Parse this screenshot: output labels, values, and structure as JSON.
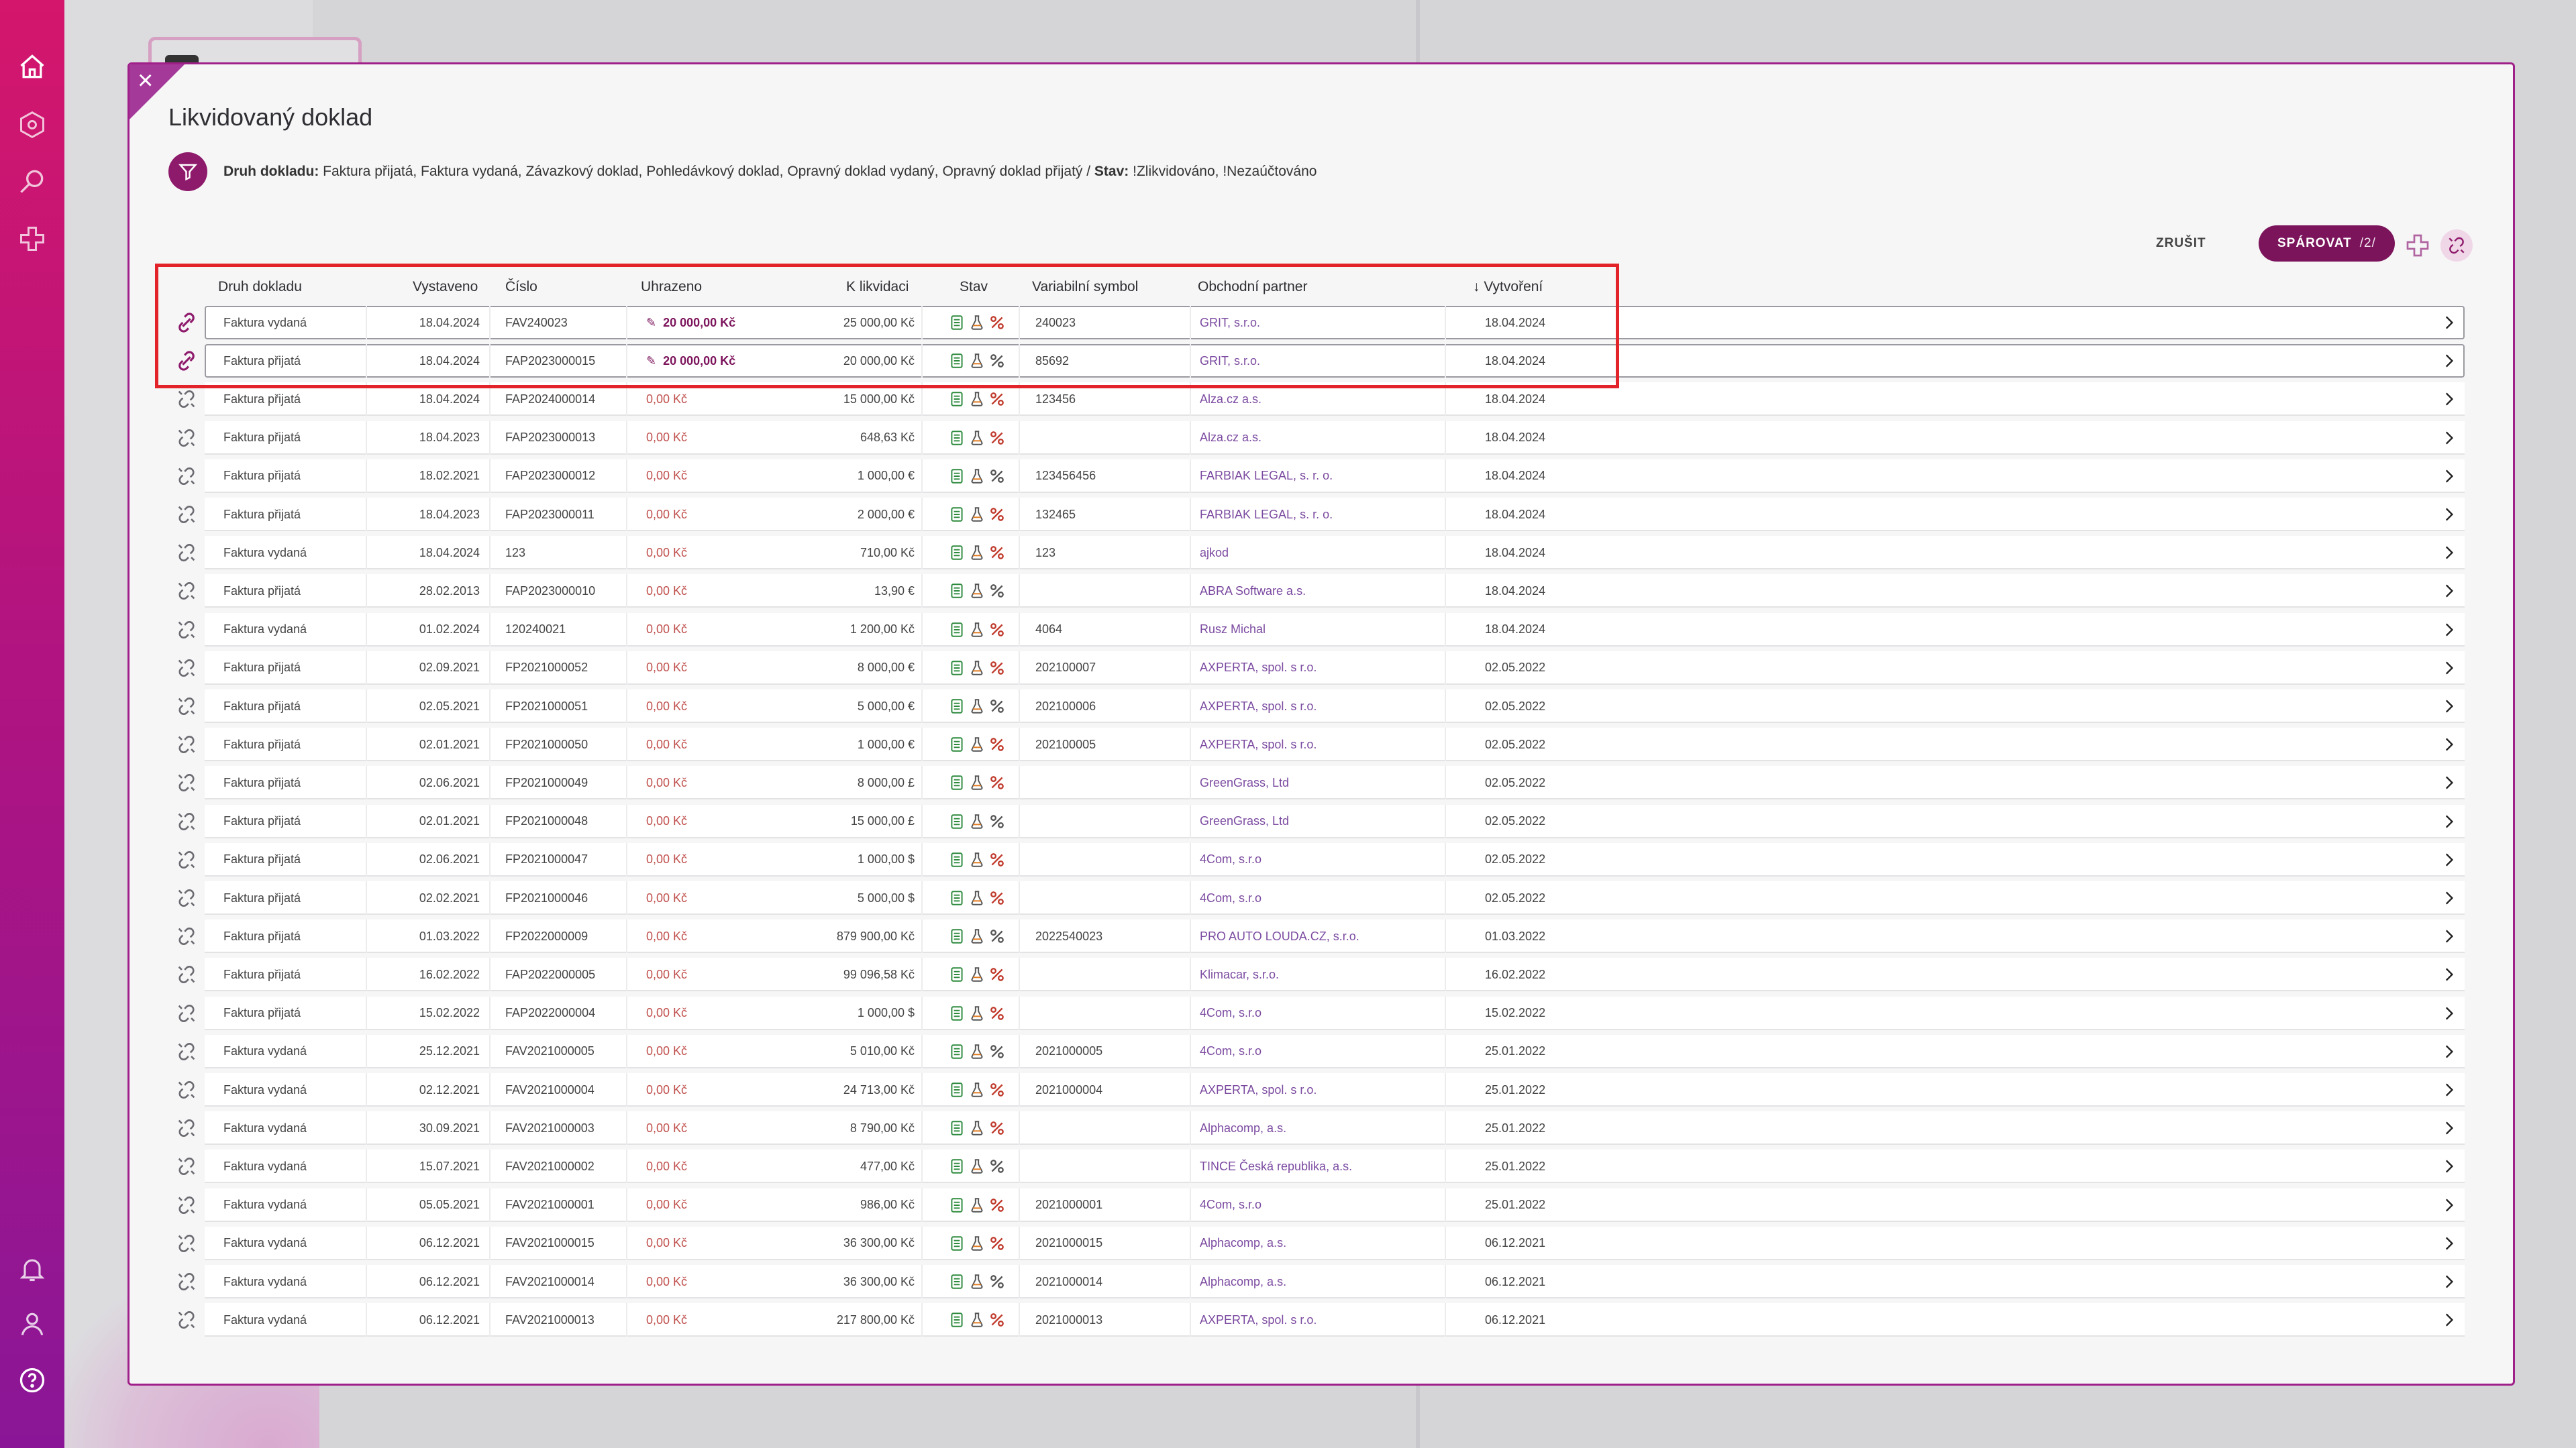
{
  "modal": {
    "title": "Likvidovaný doklad",
    "close_glyph": "×",
    "filter": {
      "label_doc_type": "Druh dokladu:",
      "doc_types": " Faktura přijatá, Faktura vydaná, Závazkový doklad, Pohledávkový doklad, Opravný doklad vydaný, Opravný doklad přijatý / ",
      "label_state": "Stav:",
      "states": " !Zlikvidováno, !Nezaúčtováno"
    },
    "actions": {
      "cancel_label": "ZRUŠIT",
      "pair_label": "SPÁROVAT",
      "pair_count": "/2/"
    }
  },
  "table": {
    "headers": {
      "doc_type": "Druh dokladu",
      "issued": "Vystaveno",
      "number": "Číslo",
      "paid": "Uhrazeno",
      "to_liquidate": "K likvidaci",
      "state": "Stav",
      "var_symbol": "Variabilní symbol",
      "partner": "Obchodní partner",
      "created": "↓ Vytvoření"
    },
    "rows": [
      {
        "doc_type": "Faktura vydaná",
        "issued": "18.04.2024",
        "number": "FAV240023",
        "paid": "20 000,00 Kč",
        "to_liquidate": "25 000,00 Kč",
        "var_symbol": "240023",
        "partner": "GRIT, s.r.o.",
        "created": "18.04.2024"
      },
      {
        "doc_type": "Faktura přijatá",
        "issued": "18.04.2024",
        "number": "FAP2023000015",
        "paid": "20 000,00 Kč",
        "to_liquidate": "20 000,00 Kč",
        "var_symbol": "85692",
        "partner": "GRIT, s.r.o.",
        "created": "18.04.2024"
      },
      {
        "doc_type": "Faktura přijatá",
        "issued": "18.04.2024",
        "number": "FAP2024000014",
        "paid": "0,00 Kč",
        "to_liquidate": "15 000,00 Kč",
        "var_symbol": "123456",
        "partner": "Alza.cz a.s.",
        "created": "18.04.2024"
      },
      {
        "doc_type": "Faktura přijatá",
        "issued": "18.04.2023",
        "number": "FAP2023000013",
        "paid": "0,00 Kč",
        "to_liquidate": "648,63 Kč",
        "var_symbol": "",
        "partner": "Alza.cz a.s.",
        "created": "18.04.2024"
      },
      {
        "doc_type": "Faktura přijatá",
        "issued": "18.02.2021",
        "number": "FAP2023000012",
        "paid": "0,00 Kč",
        "to_liquidate": "1 000,00 €",
        "var_symbol": "123456456",
        "partner": "FARBIAK LEGAL, s. r. o.",
        "created": "18.04.2024"
      },
      {
        "doc_type": "Faktura přijatá",
        "issued": "18.04.2023",
        "number": "FAP2023000011",
        "paid": "0,00 Kč",
        "to_liquidate": "2 000,00 €",
        "var_symbol": "132465",
        "partner": "FARBIAK LEGAL, s. r. o.",
        "created": "18.04.2024"
      },
      {
        "doc_type": "Faktura vydaná",
        "issued": "18.04.2024",
        "number": "123",
        "paid": "0,00 Kč",
        "to_liquidate": "710,00 Kč",
        "var_symbol": "123",
        "partner": "ajkod",
        "created": "18.04.2024"
      },
      {
        "doc_type": "Faktura přijatá",
        "issued": "28.02.2013",
        "number": "FAP2023000010",
        "paid": "0,00 Kč",
        "to_liquidate": "13,90 €",
        "var_symbol": "",
        "partner": "ABRA Software a.s.",
        "created": "18.04.2024"
      },
      {
        "doc_type": "Faktura vydaná",
        "issued": "01.02.2024",
        "number": "120240021",
        "paid": "0,00 Kč",
        "to_liquidate": "1 200,00 Kč",
        "var_symbol": "4064",
        "partner": "Rusz Michal",
        "created": "18.04.2024"
      },
      {
        "doc_type": "Faktura přijatá",
        "issued": "02.09.2021",
        "number": "FP2021000052",
        "paid": "0,00 Kč",
        "to_liquidate": "8 000,00 €",
        "var_symbol": "202100007",
        "partner": "AXPERTA, spol. s r.o.",
        "created": "02.05.2022"
      },
      {
        "doc_type": "Faktura přijatá",
        "issued": "02.05.2021",
        "number": "FP2021000051",
        "paid": "0,00 Kč",
        "to_liquidate": "5 000,00 €",
        "var_symbol": "202100006",
        "partner": "AXPERTA, spol. s r.o.",
        "created": "02.05.2022"
      },
      {
        "doc_type": "Faktura přijatá",
        "issued": "02.01.2021",
        "number": "FP2021000050",
        "paid": "0,00 Kč",
        "to_liquidate": "1 000,00 €",
        "var_symbol": "202100005",
        "partner": "AXPERTA, spol. s r.o.",
        "created": "02.05.2022"
      },
      {
        "doc_type": "Faktura přijatá",
        "issued": "02.06.2021",
        "number": "FP2021000049",
        "paid": "0,00 Kč",
        "to_liquidate": "8 000,00 £",
        "var_symbol": "",
        "partner": "GreenGrass, Ltd",
        "created": "02.05.2022"
      },
      {
        "doc_type": "Faktura přijatá",
        "issued": "02.01.2021",
        "number": "FP2021000048",
        "paid": "0,00 Kč",
        "to_liquidate": "15 000,00 £",
        "var_symbol": "",
        "partner": "GreenGrass, Ltd",
        "created": "02.05.2022"
      },
      {
        "doc_type": "Faktura přijatá",
        "issued": "02.06.2021",
        "number": "FP2021000047",
        "paid": "0,00 Kč",
        "to_liquidate": "1 000,00 $",
        "var_symbol": "",
        "partner": "4Com, s.r.o",
        "created": "02.05.2022"
      },
      {
        "doc_type": "Faktura přijatá",
        "issued": "02.02.2021",
        "number": "FP2021000046",
        "paid": "0,00 Kč",
        "to_liquidate": "5 000,00 $",
        "var_symbol": "",
        "partner": "4Com, s.r.o",
        "created": "02.05.2022"
      },
      {
        "doc_type": "Faktura přijatá",
        "issued": "01.03.2022",
        "number": "FP2022000009",
        "paid": "0,00 Kč",
        "to_liquidate": "879 900,00 Kč",
        "var_symbol": "2022540023",
        "partner": "PRO AUTO LOUDA.CZ, s.r.o.",
        "created": "01.03.2022"
      },
      {
        "doc_type": "Faktura přijatá",
        "issued": "16.02.2022",
        "number": "FAP2022000005",
        "paid": "0,00 Kč",
        "to_liquidate": "99 096,58 Kč",
        "var_symbol": "",
        "partner": "Klimacar, s.r.o.",
        "created": "16.02.2022"
      },
      {
        "doc_type": "Faktura přijatá",
        "issued": "15.02.2022",
        "number": "FAP2022000004",
        "paid": "0,00 Kč",
        "to_liquidate": "1 000,00 $",
        "var_symbol": "",
        "partner": "4Com, s.r.o",
        "created": "15.02.2022"
      },
      {
        "doc_type": "Faktura vydaná",
        "issued": "25.12.2021",
        "number": "FAV2021000005",
        "paid": "0,00 Kč",
        "to_liquidate": "5 010,00 Kč",
        "var_symbol": "2021000005",
        "partner": "4Com, s.r.o",
        "created": "25.01.2022"
      },
      {
        "doc_type": "Faktura vydaná",
        "issued": "02.12.2021",
        "number": "FAV2021000004",
        "paid": "0,00 Kč",
        "to_liquidate": "24 713,00 Kč",
        "var_symbol": "2021000004",
        "partner": "AXPERTA, spol. s r.o.",
        "created": "25.01.2022"
      },
      {
        "doc_type": "Faktura vydaná",
        "issued": "30.09.2021",
        "number": "FAV2021000003",
        "paid": "0,00 Kč",
        "to_liquidate": "8 790,00 Kč",
        "var_symbol": "",
        "partner": "Alphacomp, a.s.",
        "created": "25.01.2022"
      },
      {
        "doc_type": "Faktura vydaná",
        "issued": "15.07.2021",
        "number": "FAV2021000002",
        "paid": "0,00 Kč",
        "to_liquidate": "477,00 Kč",
        "var_symbol": "",
        "partner": "TINCE Česká republika, a.s.",
        "created": "25.01.2022"
      },
      {
        "doc_type": "Faktura vydaná",
        "issued": "05.05.2021",
        "number": "FAV2021000001",
        "paid": "0,00 Kč",
        "to_liquidate": "986,00 Kč",
        "var_symbol": "2021000001",
        "partner": "4Com, s.r.o",
        "created": "25.01.2022"
      },
      {
        "doc_type": "Faktura vydaná",
        "issued": "06.12.2021",
        "number": "FAV2021000015",
        "paid": "0,00 Kč",
        "to_liquidate": "36 300,00 Kč",
        "var_symbol": "2021000015",
        "partner": "Alphacomp, a.s.",
        "created": "06.12.2021"
      },
      {
        "doc_type": "Faktura vydaná",
        "issued": "06.12.2021",
        "number": "FAV2021000014",
        "paid": "0,00 Kč",
        "to_liquidate": "36 300,00 Kč",
        "var_symbol": "2021000014",
        "partner": "Alphacomp, a.s.",
        "created": "06.12.2021"
      },
      {
        "doc_type": "Faktura vydaná",
        "issued": "06.12.2021",
        "number": "FAV2021000013",
        "paid": "0,00 Kč",
        "to_liquidate": "217 800,00 Kč",
        "var_symbol": "2021000013",
        "partner": "AXPERTA, spol. s r.o.",
        "created": "06.12.2021"
      }
    ]
  }
}
